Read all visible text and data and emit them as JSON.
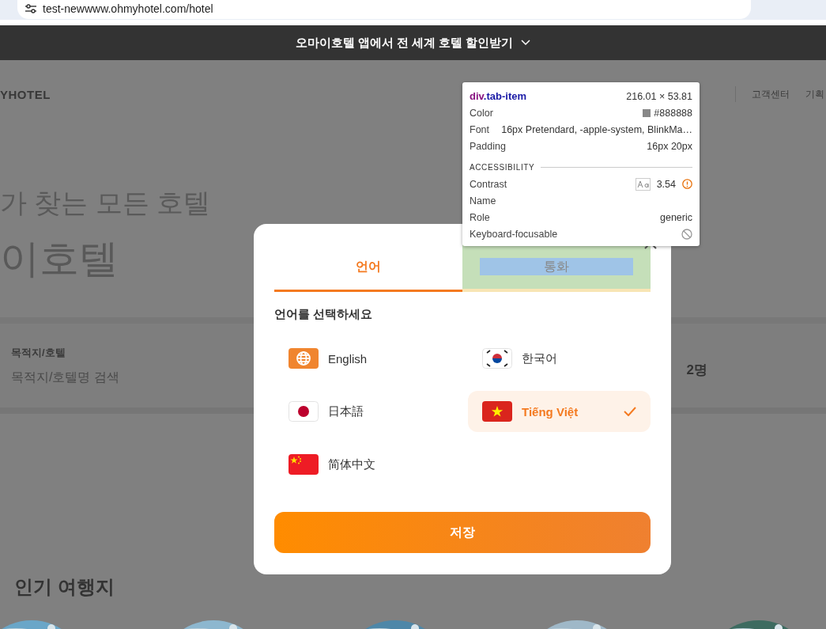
{
  "browser": {
    "address": "test-newwww.ohmyhotel.com/hotel"
  },
  "banner": {
    "text": "오마이호텔 앱에서 전 세계 호텔 할인받기"
  },
  "background_page": {
    "logo": "YHOTEL",
    "nav": [
      "고객센터",
      "기획"
    ],
    "hero_lines": [
      "가 찾는 모든 호텔",
      "이호텔"
    ],
    "search": {
      "label": "목적지/호텔",
      "placeholder": "목적지/호텔명 검색",
      "guests": "2명"
    },
    "section_title": "인기 여행지",
    "destinations": [
      {
        "kind": "picture"
      },
      {
        "kind": "picture"
      },
      {
        "kind": "picture"
      },
      {
        "kind": "picture"
      },
      {
        "kind": "picture"
      }
    ]
  },
  "modal": {
    "tabs": [
      {
        "label": "언어",
        "selected": true,
        "inspected": false
      },
      {
        "label": "통화",
        "selected": false,
        "inspected": true
      }
    ],
    "prompt": "언어를 선택하세요",
    "languages": [
      {
        "label": "English",
        "kind": "globe",
        "selected": false
      },
      {
        "label": "한국어",
        "kind": "kr",
        "selected": false
      },
      {
        "label": "日本語",
        "kind": "jp",
        "selected": false
      },
      {
        "label": "Tiếng Việt",
        "kind": "vn",
        "selected": true
      },
      {
        "label": "简体中文",
        "kind": "cn",
        "selected": false
      }
    ],
    "save": "저장"
  },
  "devtools_tooltip": {
    "tag": "div",
    "class_name": ".tab-item",
    "size": "216.01 × 53.81",
    "rows": [
      {
        "kind": "swatch",
        "label": "Color",
        "value": "#888888"
      },
      {
        "kind": "text",
        "label": "Font",
        "value": "16px Pretendard, -apple-system, BlinkMa…"
      },
      {
        "kind": "text",
        "label": "Padding",
        "value": "16px 20px"
      }
    ],
    "section": "ACCESSIBILITY",
    "a11y_rows": [
      {
        "kind": "contrast",
        "label": "Contrast",
        "value": "3.54"
      },
      {
        "kind": "empty",
        "label": "Name"
      },
      {
        "kind": "text",
        "label": "Role",
        "value": "generic"
      },
      {
        "kind": "blocked",
        "label": "Keyboard-focusable"
      }
    ]
  }
}
